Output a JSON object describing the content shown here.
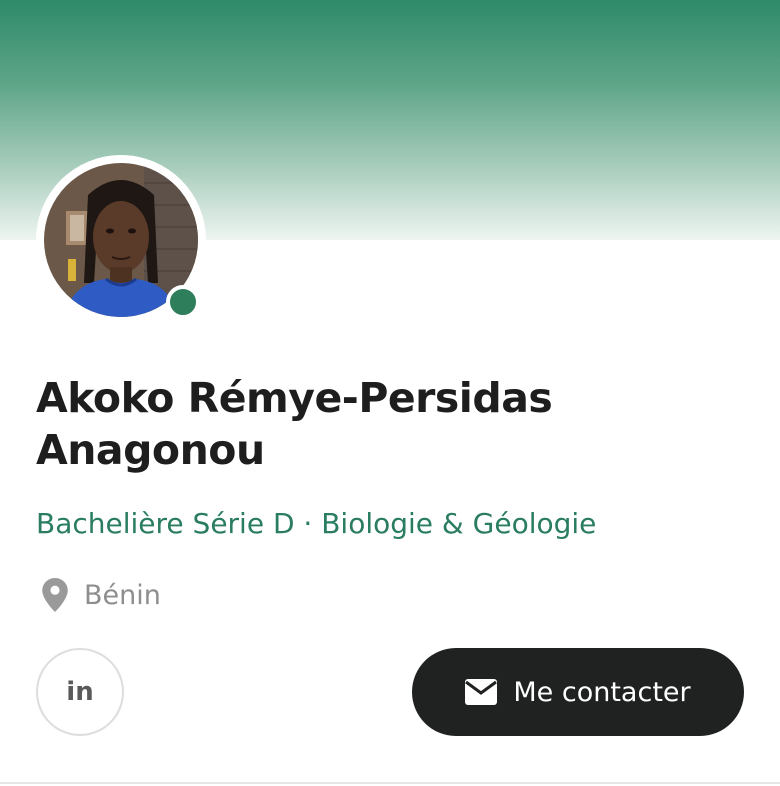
{
  "profile": {
    "name": "Akoko Rémye-Persidas Anagonou",
    "headline": "Bachelière Série D · Biologie & Géologie",
    "location": "Bénin",
    "status": "online",
    "avatar_icon": "profile-photo"
  },
  "actions": {
    "linkedin_label": "in",
    "contact_label": "Me contacter",
    "contact_icon": "envelope-icon"
  },
  "colors": {
    "accent": "#2e7d5b",
    "banner_top": "#2e8a6a",
    "contact_button_bg": "#1f2220",
    "name_text": "#1e1e1e",
    "headline_text": "#2a7d5f",
    "location_text": "#8e8e8e"
  }
}
